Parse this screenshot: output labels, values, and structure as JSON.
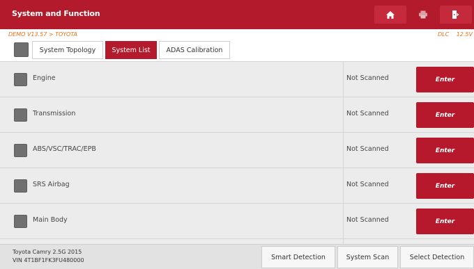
{
  "titlebar": {
    "title": "System and Function",
    "home_icon": "home-icon",
    "print_icon": "print-icon",
    "exit_icon": "exit-icon"
  },
  "infobar": {
    "path": "DEMO V13.57 > TOYOTA",
    "dlc": "DLC",
    "voltage": "12.5V"
  },
  "tabs": [
    {
      "label": "System Topology",
      "active": false
    },
    {
      "label": "System List",
      "active": true
    },
    {
      "label": "ADAS Calibration",
      "active": false
    }
  ],
  "systems": [
    {
      "name": "Engine",
      "status": "Not Scanned",
      "action": "Enter"
    },
    {
      "name": "Transmission",
      "status": "Not Scanned",
      "action": "Enter"
    },
    {
      "name": "ABS/VSC/TRAC/EPB",
      "status": "Not Scanned",
      "action": "Enter"
    },
    {
      "name": "SRS Airbag",
      "status": "Not Scanned",
      "action": "Enter"
    },
    {
      "name": "Main Body",
      "status": "Not Scanned",
      "action": "Enter"
    }
  ],
  "footer": {
    "vehicle_line1": "Toyota Camry 2.5G 2015",
    "vehicle_line2": "VIN 4T1BF1FK3FU480000",
    "buttons": [
      "Smart Detection",
      "System Scan",
      "Select Detection"
    ]
  },
  "colors": {
    "accent": "#b31a2b",
    "info_text": "#e4731a"
  }
}
